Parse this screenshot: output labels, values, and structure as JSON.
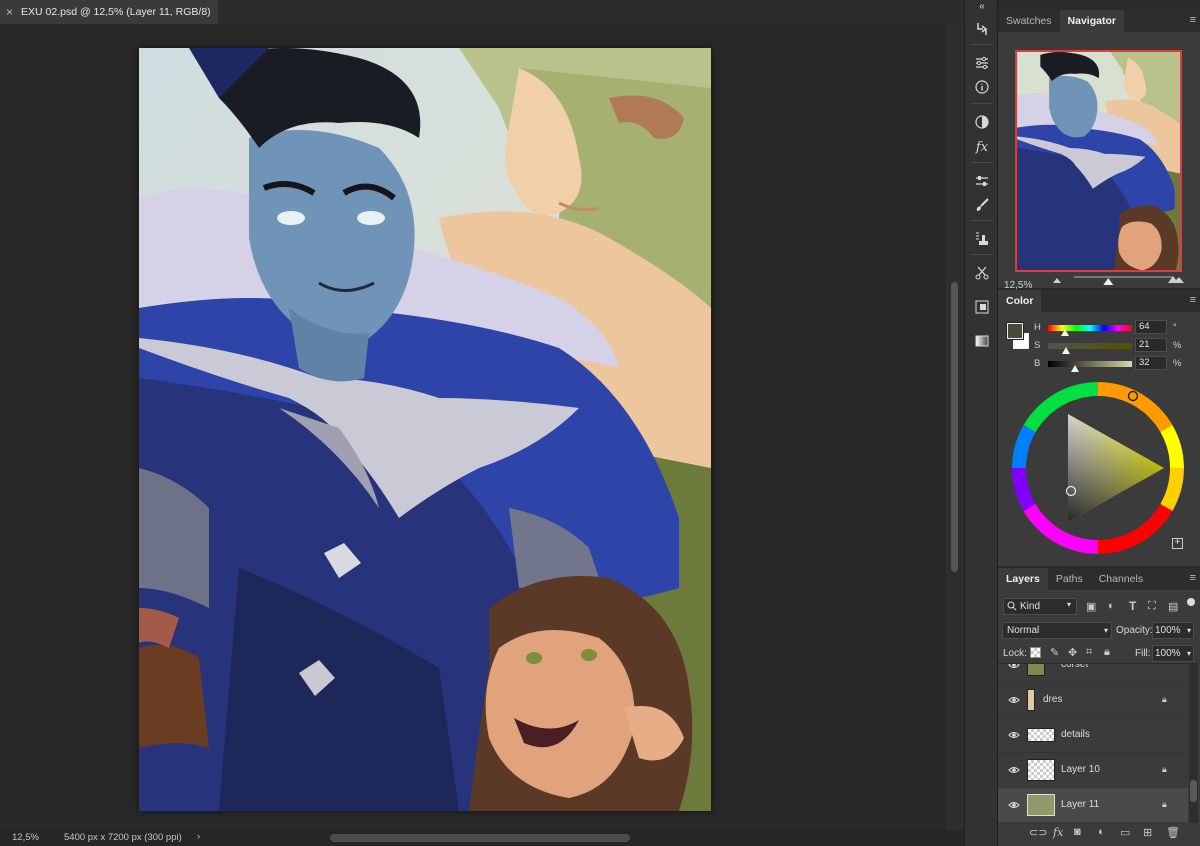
{
  "document": {
    "tab_title": "EXU 02.psd @ 12,5% (Layer 11, RGB/8)",
    "close_glyph": "×",
    "zoom": "12,5%",
    "dimensions": "5400 px x 7200 px (300 ppi)",
    "status_arrow": "›"
  },
  "toolbar": {
    "collapse_glyph": "«",
    "icons": [
      "history-icon",
      "properties-icon",
      "info-icon",
      "adjustments-icon",
      "styles-icon",
      "brush-settings-icon",
      "brushes-icon",
      "clone-source-icon",
      "tool-presets-icon",
      "scissors-icon",
      "paths-icon",
      "gradients-icon"
    ]
  },
  "navigator": {
    "tabs": [
      "Swatches",
      "Navigator"
    ],
    "active_tab": "Navigator",
    "zoom": "12,5%",
    "zoom_slider_value": 0.35,
    "menu_glyph": "≡"
  },
  "color": {
    "tab": "Color",
    "menu_glyph": "≡",
    "foreground": "#4a4a3a",
    "background": "#ffffff",
    "h_label": "H",
    "h_value": "64",
    "h_unit": "°",
    "s_label": "S",
    "s_value": "21",
    "s_unit": "%",
    "b_label": "B",
    "b_value": "32",
    "b_unit": "%",
    "add_glyph": "+"
  },
  "layers": {
    "tabs": [
      "Layers",
      "Paths",
      "Channels"
    ],
    "active_tab": "Layers",
    "menu_glyph": "≡",
    "filter_kind": "Kind",
    "blend_mode": "Normal",
    "opacity_label": "Opacity:",
    "opacity_value": "100%",
    "lock_label": "Lock:",
    "fill_label": "Fill:",
    "fill_value": "100%",
    "items": [
      {
        "name": "corset",
        "locked": false
      },
      {
        "name": "dres",
        "locked": true
      },
      {
        "name": "details",
        "locked": false
      },
      {
        "name": "Layer 10",
        "locked": true
      },
      {
        "name": "Layer 11",
        "locked": true,
        "selected": true
      }
    ],
    "bottom_icons": [
      "link-icon",
      "fx-icon",
      "mask-icon",
      "adjustment-layer-icon",
      "group-icon",
      "new-layer-icon",
      "trash-icon"
    ]
  }
}
